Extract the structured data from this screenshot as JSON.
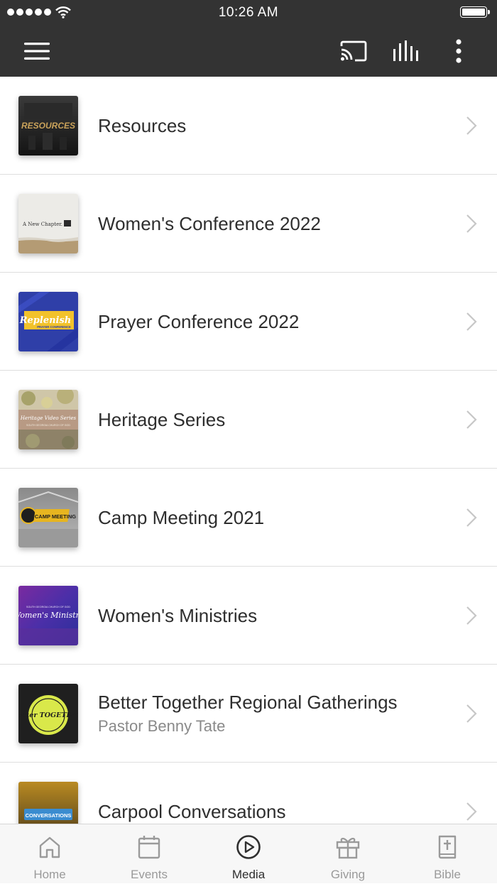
{
  "status_bar": {
    "time": "10:26 AM"
  },
  "colors": {
    "header_bg": "#333333",
    "tab_active": "#2f2f2f",
    "tab_inactive": "#9a9a9a",
    "chevron": "#c7c7c7"
  },
  "icons": {
    "toolbar": [
      "hamburger-menu-icon",
      "cast-icon",
      "equalizer-icon",
      "more-vertical-icon"
    ],
    "row": "chevron-right-icon"
  },
  "media": {
    "items": [
      {
        "title": "Resources",
        "subtitle": "",
        "thumb_text": "RESOURCES"
      },
      {
        "title": "Women's Conference 2022",
        "subtitle": "",
        "thumb_text": "A New Chapter."
      },
      {
        "title": "Prayer Conference 2022",
        "subtitle": "",
        "thumb_text": "Replenish",
        "thumb_subtext": "PRAYER CONFERENCE"
      },
      {
        "title": "Heritage Series",
        "subtitle": "",
        "thumb_text": "Heritage Video Series",
        "thumb_subtext": "SOUTH GEORGIA CHURCH OF GOD"
      },
      {
        "title": "Camp Meeting 2021",
        "subtitle": "",
        "thumb_text": "CAMP MEETING"
      },
      {
        "title": "Women's Ministries",
        "subtitle": "",
        "thumb_text": "Women's Ministry",
        "thumb_subtext": "SOUTH GEORGIA CHURCH OF GOD"
      },
      {
        "title": "Better Together Regional Gatherings",
        "subtitle": "Pastor Benny Tate",
        "thumb_text": "Better TOGETHER"
      },
      {
        "title": "Carpool Conversations",
        "subtitle": "",
        "thumb_text": "CONVERSATIONS"
      }
    ]
  },
  "tabs": [
    {
      "label": "Home",
      "icon": "home-icon",
      "active": false
    },
    {
      "label": "Events",
      "icon": "calendar-icon",
      "active": false
    },
    {
      "label": "Media",
      "icon": "play-circle-icon",
      "active": true
    },
    {
      "label": "Giving",
      "icon": "gift-icon",
      "active": false
    },
    {
      "label": "Bible",
      "icon": "bible-icon",
      "active": false
    }
  ]
}
